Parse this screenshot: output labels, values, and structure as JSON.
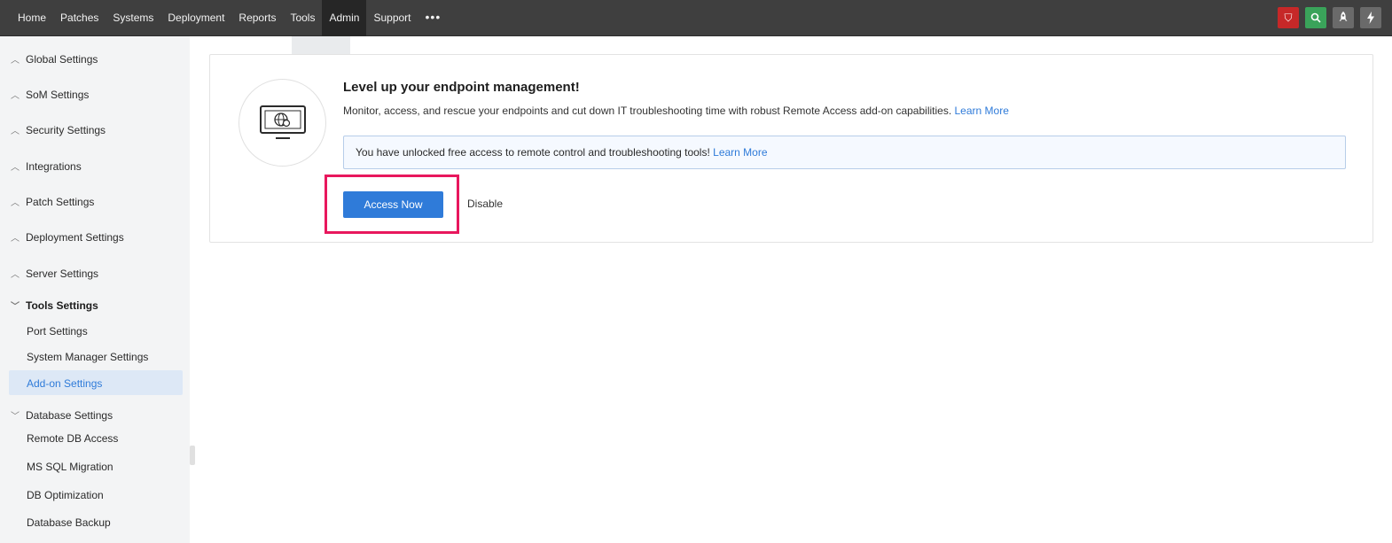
{
  "nav": {
    "items": [
      "Home",
      "Patches",
      "Systems",
      "Deployment",
      "Reports",
      "Tools",
      "Admin",
      "Support"
    ],
    "active": "Admin",
    "more": "•••"
  },
  "top_icons": [
    {
      "name": "shield-icon",
      "color": "#c62828",
      "glyph": "⛉"
    },
    {
      "name": "search-icon",
      "color": "#3aa35a",
      "glyph": "🔍"
    },
    {
      "name": "rocket-icon",
      "color": "#6a6a6a",
      "glyph": "🚀"
    },
    {
      "name": "bolt-icon",
      "color": "#6a6a6a",
      "glyph": "⚡"
    }
  ],
  "sidebar": {
    "sections": [
      "Global Settings",
      "SoM Settings",
      "Security Settings",
      "Integrations",
      "Patch Settings",
      "Deployment Settings",
      "Server Settings",
      "Tools Settings",
      "Database Settings"
    ],
    "tools_items": [
      "Port Settings",
      "System Manager Settings",
      "Add-on Settings"
    ],
    "database_items": [
      "Remote DB Access",
      "MS SQL Migration",
      "DB Optimization",
      "Database Backup"
    ],
    "active_item": "Add-on Settings"
  },
  "card": {
    "title": "Level up your endpoint management!",
    "description": "Monitor, access, and rescue your endpoints and cut down IT troubleshooting time with robust Remote Access add-on capabilities.",
    "description_link": "Learn More",
    "info_text": "You have unlocked free access to remote control and troubleshooting tools!",
    "info_link": "Learn More",
    "primary_button": "Access Now",
    "secondary_button": "Disable"
  },
  "colors": {
    "accent": "#2f7bd9",
    "highlight": "#e8175d",
    "topbar": "#3f3f3f"
  }
}
